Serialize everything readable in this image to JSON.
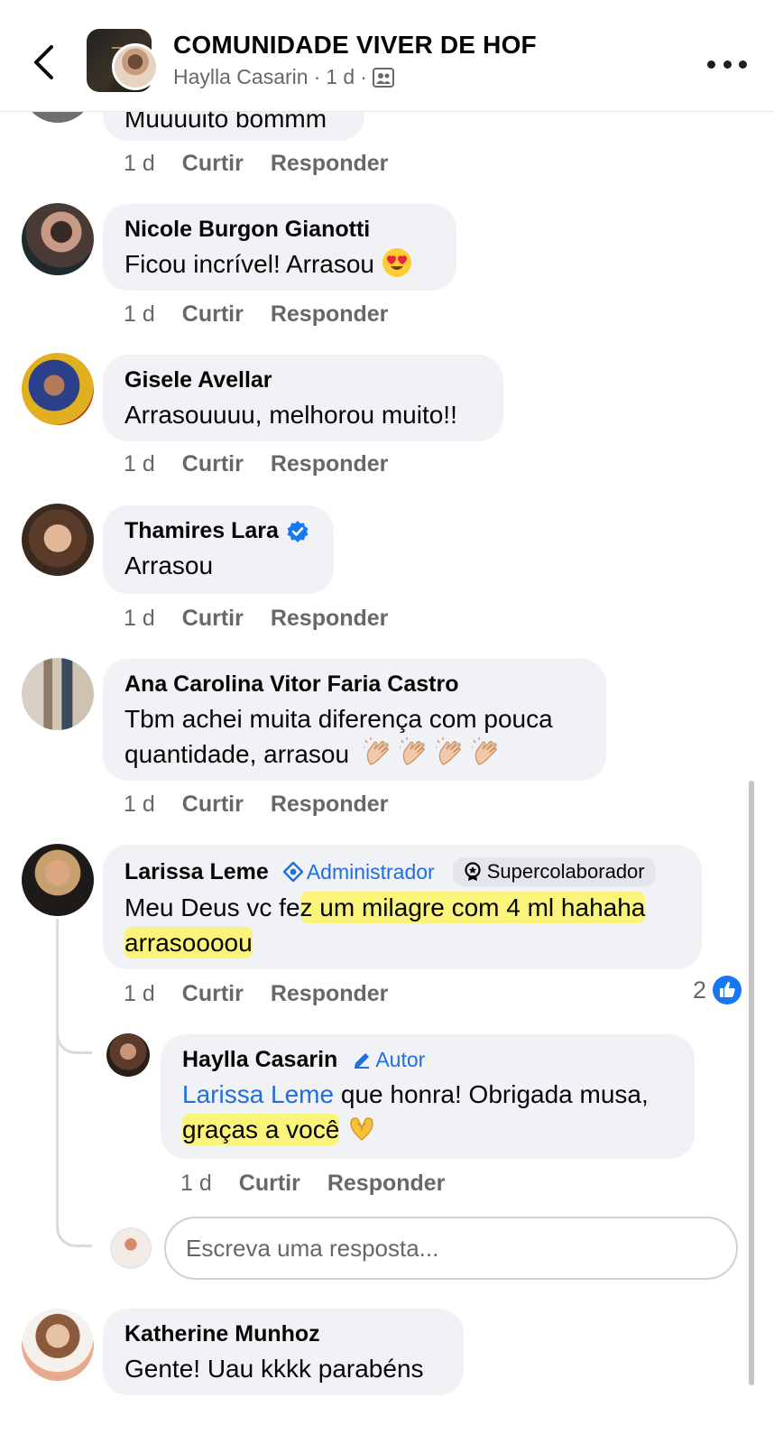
{
  "header": {
    "title": "COMUNIDADE VIVER DE HOF",
    "author": "Haylla Casarin",
    "time": "1 d",
    "sep1": "·",
    "sep2": "·"
  },
  "comments": [
    {
      "name": "",
      "text": "Muuuuito bommm",
      "time": "1 d",
      "like_label": "Curtir",
      "reply_label": "Responder"
    },
    {
      "name": "Nicole Burgon Gianotti",
      "text": "Ficou incrível! Arrasou",
      "emoji": "heart-eyes",
      "time": "1 d",
      "like_label": "Curtir",
      "reply_label": "Responder"
    },
    {
      "name": "Gisele Avellar",
      "text": "Arrasouuuu, melhorou muito!!",
      "time": "1 d",
      "like_label": "Curtir",
      "reply_label": "Responder"
    },
    {
      "name": "Thamires Lara",
      "verified": true,
      "text": "Arrasou",
      "time": "1 d",
      "like_label": "Curtir",
      "reply_label": "Responder"
    },
    {
      "name": "Ana Carolina Vitor Faria Castro",
      "text_line1": "Tbm achei muita diferença com pouca",
      "text_line2": "quantidade, arrasou",
      "emoji": "clapping-hands",
      "emoji_count": 4,
      "time": "1 d",
      "like_label": "Curtir",
      "reply_label": "Responder"
    },
    {
      "name": "Larissa Leme",
      "admin_badge": "Administrador",
      "super_badge": "Supercolaborador",
      "text_line1_a": "Meu Deus vc fe",
      "text_line1_b": "z um milagre com 4 ml hahaha",
      "text_line2": "arrasoooou",
      "time": "1 d",
      "like_label": "Curtir",
      "reply_label": "Responder",
      "reaction_count": "2"
    },
    {
      "name": "Katherine Munhoz",
      "text": "Gente! Uau kkkk parabéns"
    }
  ],
  "reply": {
    "name": "Haylla Casarin",
    "author_badge": "Autor",
    "mention": "Larissa Leme",
    "text_line1": " que honra! Obrigada musa,",
    "text_line2": "graças a você",
    "emoji": "heart-hands",
    "time": "1 d",
    "like_label": "Curtir",
    "reply_label": "Responder"
  },
  "reply_input": {
    "placeholder": "Escreva uma resposta..."
  },
  "colors": {
    "bubble": "#f0f2f5",
    "link_blue": "#216fdb",
    "meta_gray": "#65676b",
    "highlight": "#fff450"
  }
}
